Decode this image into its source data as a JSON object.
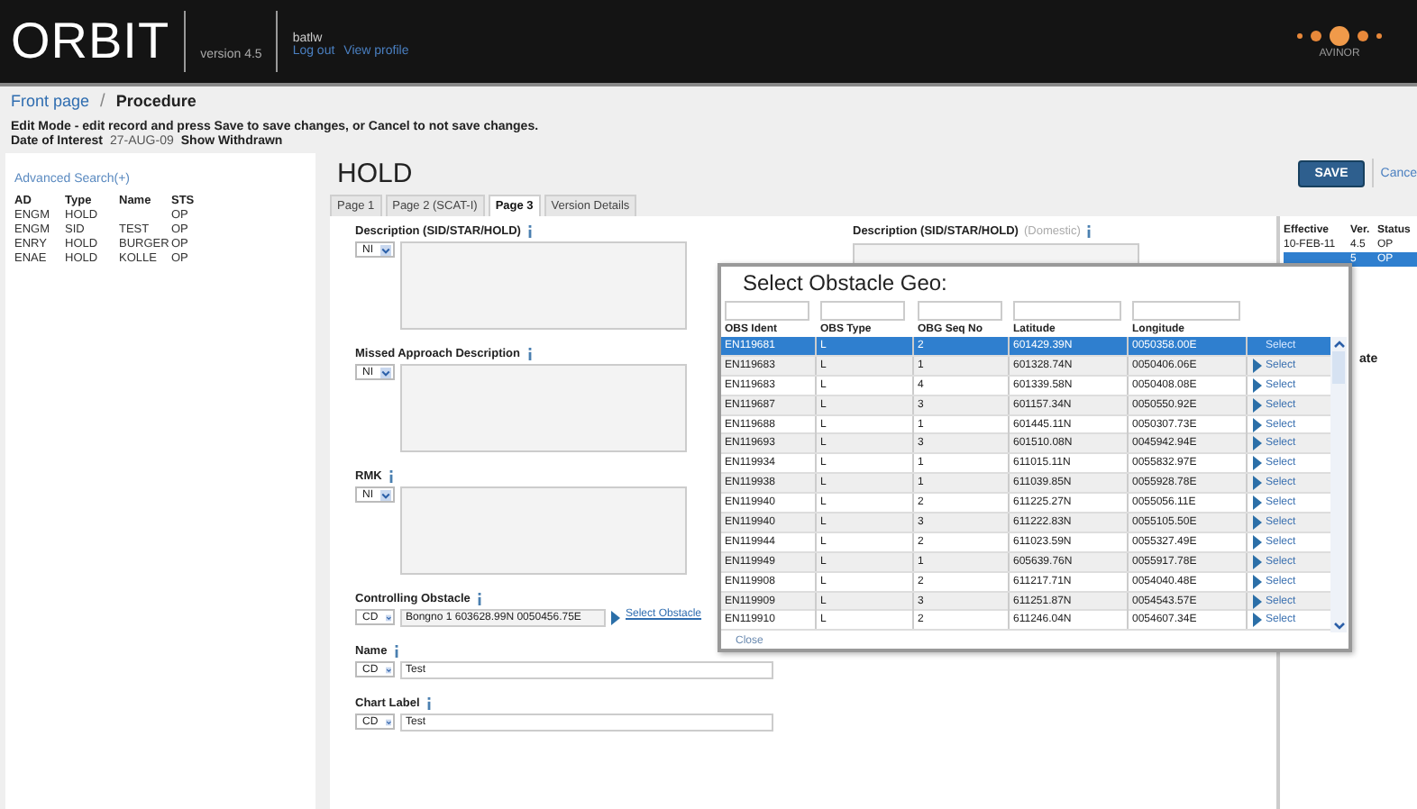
{
  "header": {
    "logo": "ORBIT",
    "version": "version 4.5",
    "user": "batlw",
    "logout": "Log out",
    "profile": "View profile",
    "brand": "AVINOR"
  },
  "breadcrumb": {
    "home": "Front page",
    "separator": "/",
    "current": "Procedure"
  },
  "instructions": "Edit Mode - edit record and press Save to save changes, or Cancel to not save changes.",
  "date_of_interest": {
    "label": "Date of Interest",
    "value": "27-AUG-09",
    "withdrawn": "Show Withdrawn"
  },
  "sidebar": {
    "advanced_search": "Advanced Search(+)",
    "columns": [
      "AD",
      "Type",
      "Name",
      "STS"
    ],
    "rows": [
      [
        "ENGM",
        "HOLD",
        "",
        "OP"
      ],
      [
        "ENGM",
        "SID",
        "TEST",
        "OP"
      ],
      [
        "ENRY",
        "HOLD",
        "BURGER",
        "OP"
      ],
      [
        "ENAE",
        "HOLD",
        "KOLLE",
        "OP"
      ]
    ]
  },
  "title": "HOLD",
  "save": "SAVE",
  "cancel": "Cance",
  "tabs": [
    {
      "label": "Page 1",
      "selected": false
    },
    {
      "label": "Page 2 (SCAT-I)",
      "selected": false
    },
    {
      "label": "Page 3",
      "selected": true
    },
    {
      "label": "Version Details",
      "selected": false
    }
  ],
  "fields": [
    {
      "kind": "textarea",
      "label": "Description (SID/STAR/HOLD)",
      "select": "NI"
    },
    {
      "kind": "textarea",
      "label": "Missed Approach Description",
      "select": "NI"
    },
    {
      "kind": "textarea",
      "label": "RMK",
      "select": "NI"
    },
    {
      "kind": "obstacle",
      "label": "Controlling Obstacle",
      "select": "CD",
      "value": "Bongno 1 603628.99N 0050456.75E",
      "link": "Select Obstacle"
    },
    {
      "kind": "input",
      "label": "Name",
      "select": "CD",
      "value": "Test"
    },
    {
      "kind": "input",
      "label": "Chart Label",
      "select": "CD",
      "value": "Test"
    }
  ],
  "domestic_field": {
    "label": "Description (SID/STAR/HOLD)",
    "note": "(Domestic)"
  },
  "history": {
    "columns": [
      "Effective",
      "Ver.",
      "Status"
    ],
    "rows": [
      {
        "effective": "10-FEB-11",
        "ver": "4.5",
        "status": "OP",
        "selected": false
      },
      {
        "ver": "5",
        "status": "OP",
        "selected": true
      }
    ]
  },
  "history_partial_label": "ate",
  "dialog": {
    "title": "Select Obstacle Geo:",
    "columns": [
      "OBS Ident",
      "OBS Type",
      "OBG Seq No",
      "Latitude",
      "Longitude"
    ],
    "close": "Close",
    "rows": [
      {
        "cells": [
          "EN119681",
          "L",
          "2",
          "601429.39N",
          "0050358.00E"
        ],
        "select": "Select",
        "selected": true
      },
      {
        "cells": [
          "EN119683",
          "L",
          "1",
          "601328.74N",
          "0050406.06E"
        ],
        "select": "Select",
        "selected": false
      },
      {
        "cells": [
          "EN119683",
          "L",
          "4",
          "601339.58N",
          "0050408.08E"
        ],
        "select": "Select",
        "selected": false
      },
      {
        "cells": [
          "EN119687",
          "L",
          "3",
          "601157.34N",
          "0050550.92E"
        ],
        "select": "Select",
        "selected": false
      },
      {
        "cells": [
          "EN119688",
          "L",
          "1",
          "601445.11N",
          "0050307.73E"
        ],
        "select": "Select",
        "selected": false
      },
      {
        "cells": [
          "EN119693",
          "L",
          "3",
          "601510.08N",
          "0045942.94E"
        ],
        "select": "Select",
        "selected": false
      },
      {
        "cells": [
          "EN119934",
          "L",
          "1",
          "611015.11N",
          "0055832.97E"
        ],
        "select": "Select",
        "selected": false
      },
      {
        "cells": [
          "EN119938",
          "L",
          "1",
          "611039.85N",
          "0055928.78E"
        ],
        "select": "Select",
        "selected": false
      },
      {
        "cells": [
          "EN119940",
          "L",
          "2",
          "611225.27N",
          "0055056.11E"
        ],
        "select": "Select",
        "selected": false
      },
      {
        "cells": [
          "EN119940",
          "L",
          "3",
          "611222.83N",
          "0055105.50E"
        ],
        "select": "Select",
        "selected": false
      },
      {
        "cells": [
          "EN119944",
          "L",
          "2",
          "611023.59N",
          "0055327.49E"
        ],
        "select": "Select",
        "selected": false
      },
      {
        "cells": [
          "EN119949",
          "L",
          "1",
          "605639.76N",
          "0055917.78E"
        ],
        "select": "Select",
        "selected": false
      },
      {
        "cells": [
          "EN119908",
          "L",
          "2",
          "611217.71N",
          "0054040.48E"
        ],
        "select": "Select",
        "selected": false
      },
      {
        "cells": [
          "EN119909",
          "L",
          "3",
          "611251.87N",
          "0054543.57E"
        ],
        "select": "Select",
        "selected": false
      },
      {
        "cells": [
          "EN119910",
          "L",
          "2",
          "611246.04N",
          "0054607.34E"
        ],
        "select": "Select",
        "selected": false
      }
    ]
  }
}
